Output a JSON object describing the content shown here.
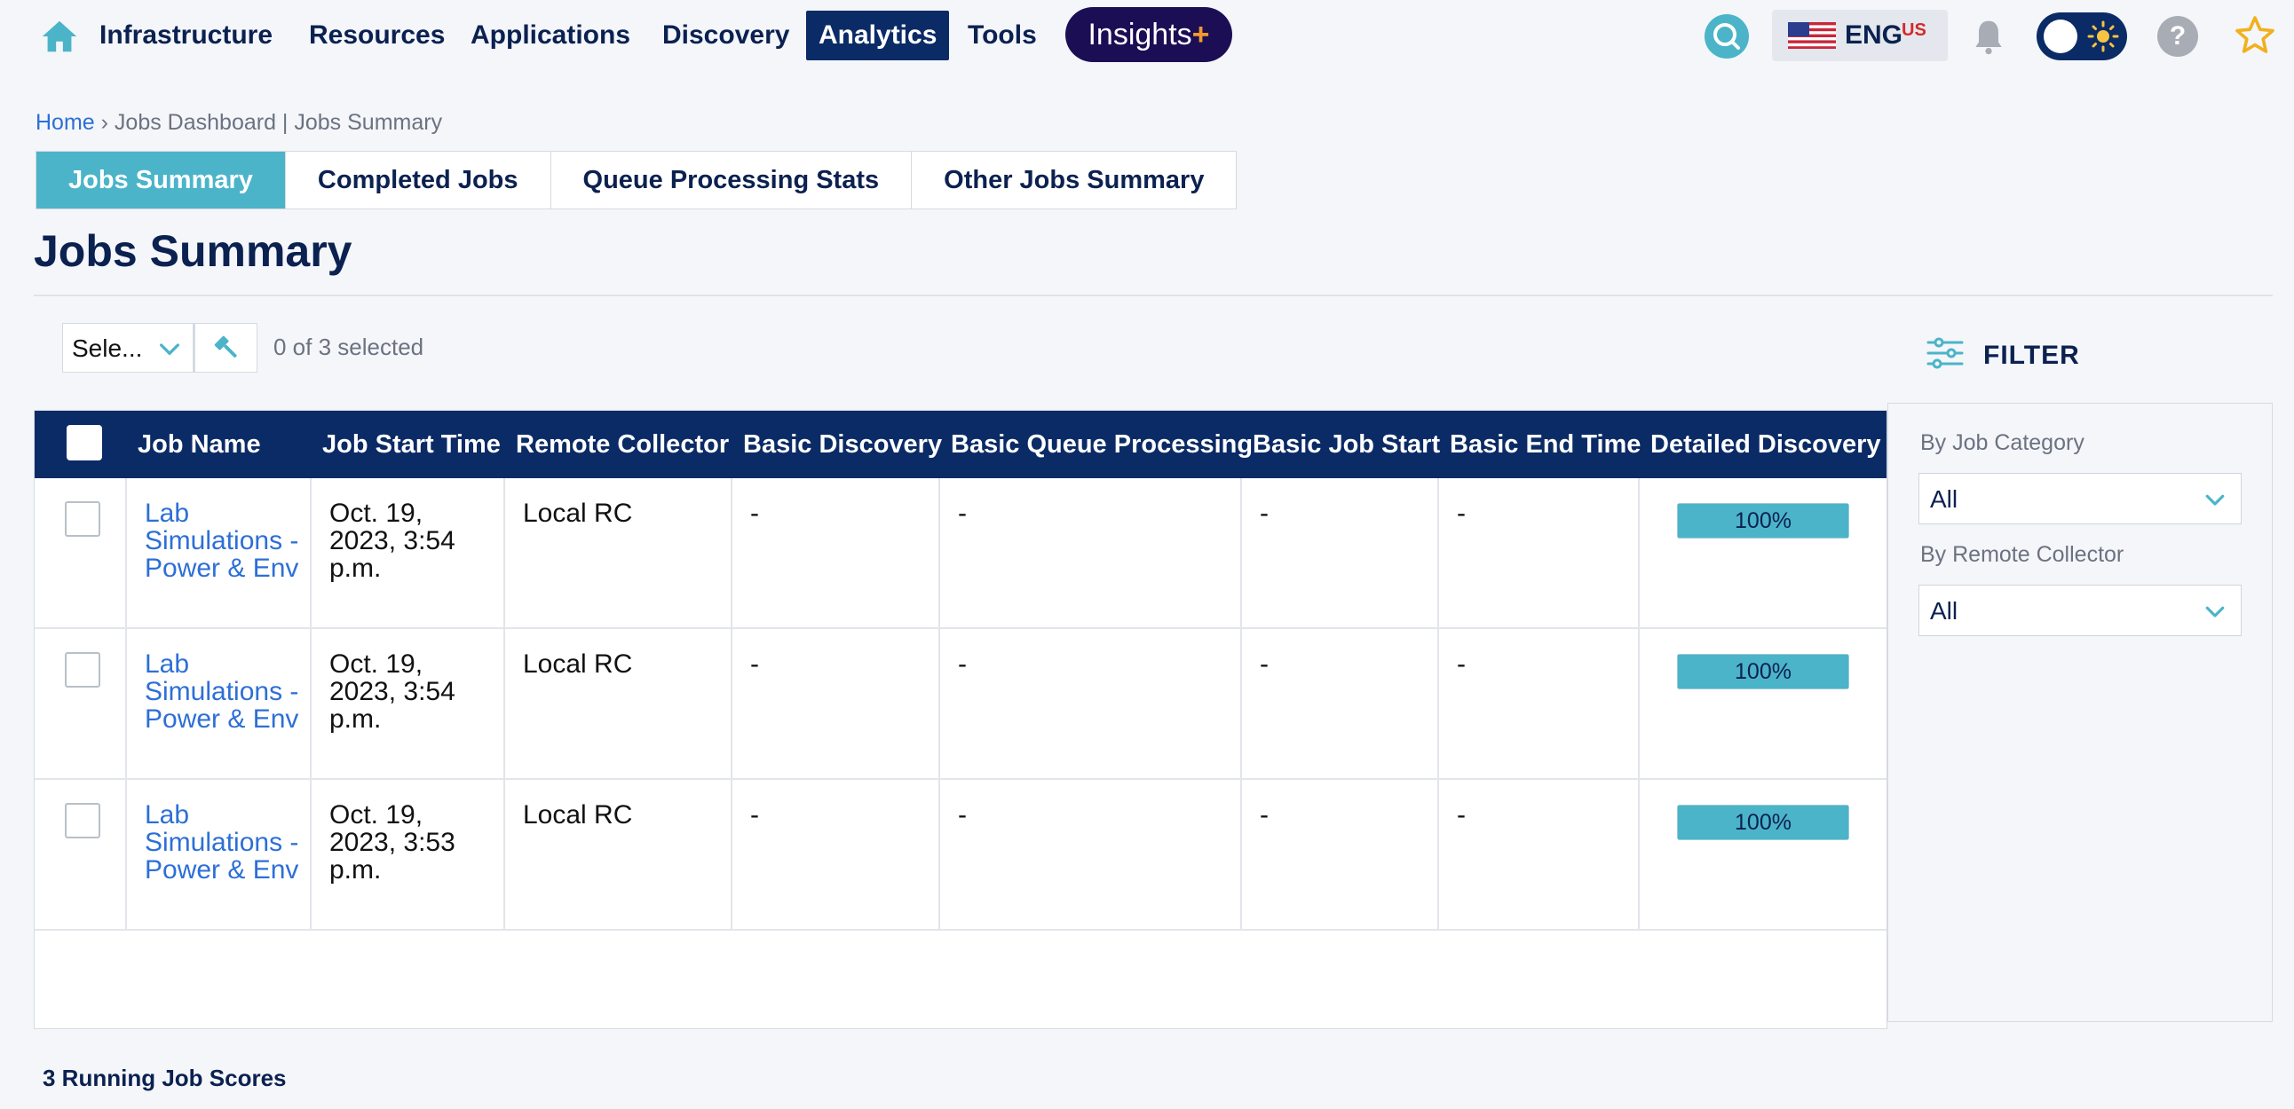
{
  "nav": {
    "items": [
      {
        "label": "Infrastructure",
        "active": false
      },
      {
        "label": "Resources",
        "active": false
      },
      {
        "label": "Applications",
        "active": false
      },
      {
        "label": "Discovery",
        "active": false
      },
      {
        "label": "Analytics",
        "active": true
      },
      {
        "label": "Tools",
        "active": false
      }
    ],
    "insights_label": "Insights",
    "insights_plus": "+",
    "language": "ENG",
    "region": "US",
    "icons": [
      "home-icon",
      "search-icon",
      "us-flag-icon",
      "bell-icon",
      "theme-toggle",
      "sun-icon",
      "help-icon",
      "star-icon"
    ]
  },
  "breadcrumb": {
    "home": "Home",
    "separator": "›",
    "rest": "Jobs Dashboard | Jobs Summary"
  },
  "tabs": [
    {
      "label": "Jobs Summary",
      "active": true
    },
    {
      "label": "Completed Jobs",
      "active": false
    },
    {
      "label": "Queue Processing Stats",
      "active": false
    },
    {
      "label": "Other Jobs Summary",
      "active": false
    }
  ],
  "page_title": "Jobs Summary",
  "toolbar": {
    "bulk_select_value": "Sele...",
    "selected_count": "0 of 3 selected"
  },
  "filter": {
    "title": "FILTER",
    "job_category_label": "By Job Category",
    "job_category_value": "All",
    "remote_collector_label": "By Remote Collector",
    "remote_collector_value": "All"
  },
  "table": {
    "headers": [
      "Job Name",
      "Job Start Time",
      "Remote Collector",
      "Basic Discovery",
      "Basic Queue Processing",
      "Basic Job Start",
      "Basic End Time",
      "Detailed Discovery"
    ],
    "rows": [
      {
        "job_name": "Lab Simulations - Power & Env",
        "start_time": "Oct. 19, 2023, 3:54 p.m.",
        "remote_collector": "Local RC",
        "basic_discovery": "-",
        "basic_queue_processing": "-",
        "basic_job_start": "-",
        "basic_end_time": "-",
        "detailed_discovery": "100%",
        "progress": 1.0
      },
      {
        "job_name": "Lab Simulations - Power & Env",
        "start_time": "Oct. 19, 2023, 3:54 p.m.",
        "remote_collector": "Local RC",
        "basic_discovery": "-",
        "basic_queue_processing": "-",
        "basic_job_start": "-",
        "basic_end_time": "-",
        "detailed_discovery": "100%",
        "progress": 1.0
      },
      {
        "job_name": "Lab Simulations - Power & Env",
        "start_time": "Oct. 19, 2023, 3:53 p.m.",
        "remote_collector": "Local RC",
        "basic_discovery": "-",
        "basic_queue_processing": "-",
        "basic_job_start": "-",
        "basic_end_time": "-",
        "detailed_discovery": "100%",
        "progress": 1.0
      }
    ]
  },
  "footer_note": "3 Running Job Scores",
  "colors": {
    "navy": "#0b2b66",
    "teal": "#4bb4c9",
    "link": "#2d6fd6",
    "insights": "#1b0e55",
    "plus": "#f29a2e"
  }
}
